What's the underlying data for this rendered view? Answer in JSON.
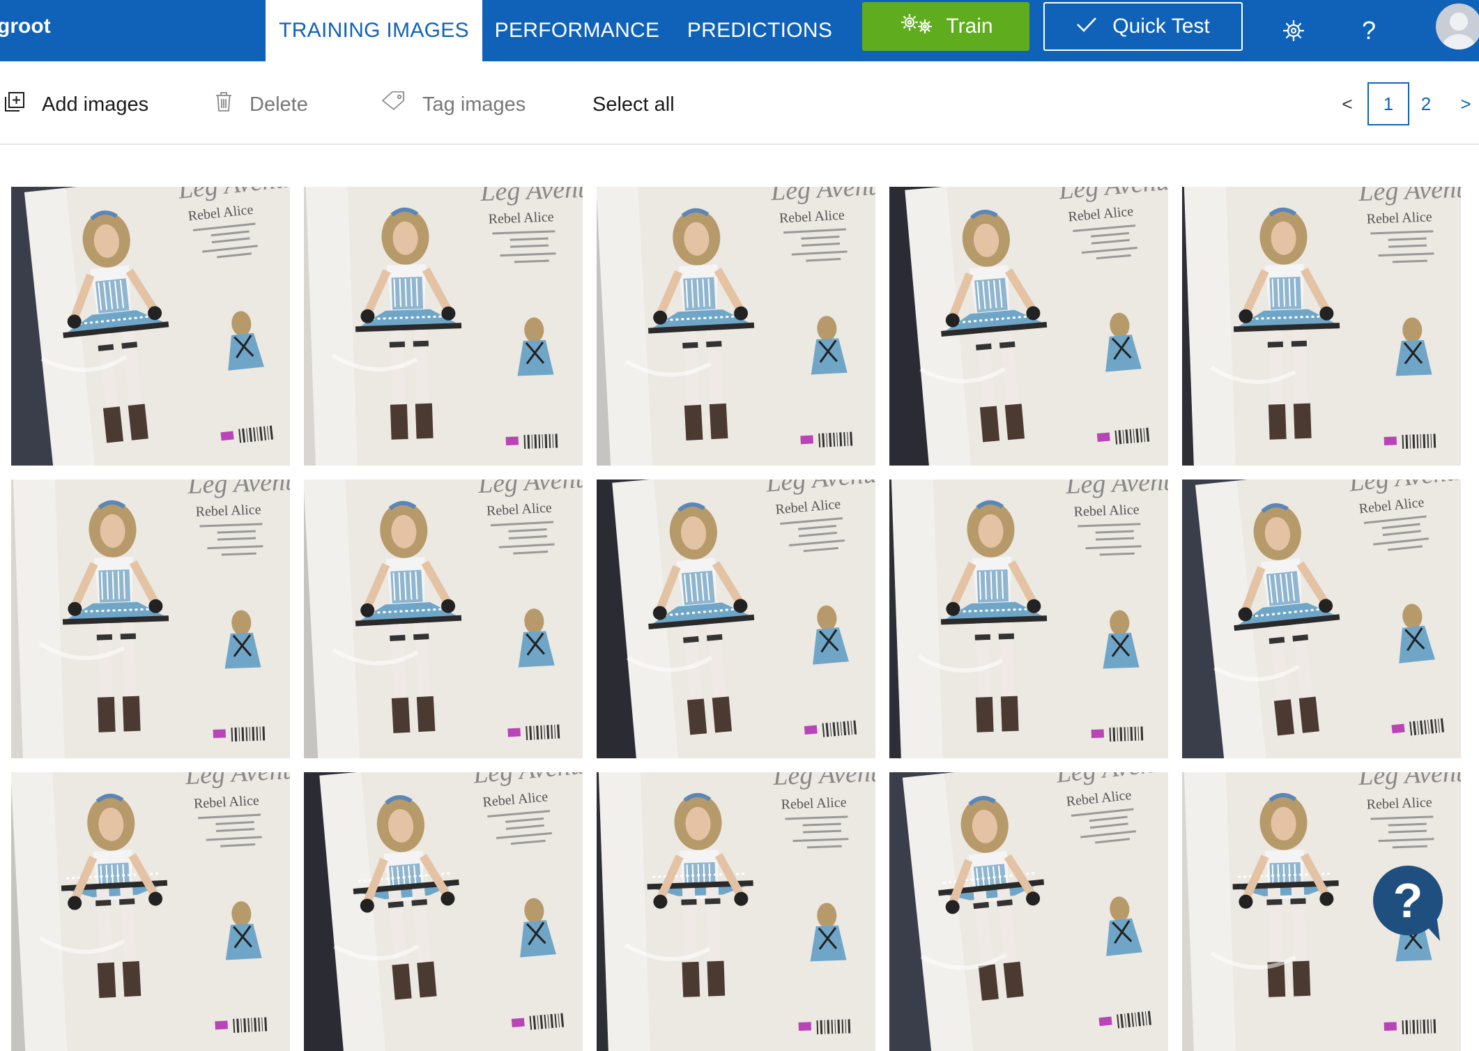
{
  "header": {
    "brand": "groot",
    "tabs": [
      {
        "label": "TRAINING IMAGES",
        "active": true
      },
      {
        "label": "PERFORMANCE",
        "active": false
      },
      {
        "label": "PREDICTIONS",
        "active": false
      }
    ],
    "train_label": "Train",
    "quick_test_label": "Quick Test",
    "help_label": "?",
    "icons": [
      "gears-icon",
      "checkmark-icon",
      "gear-icon",
      "help-icon",
      "avatar"
    ]
  },
  "toolbar": {
    "add_images": "Add images",
    "delete": "Delete",
    "tag_images": "Tag images",
    "select_all": "Select all"
  },
  "pagination": {
    "prev": "<",
    "pages": [
      "1",
      "2"
    ],
    "current": "1",
    "next": ">"
  },
  "colors": {
    "header_bg": "#0f62b8",
    "train_green": "#5fad1e",
    "help_bubble": "#1f4f7f"
  },
  "images": {
    "count_visible": 15,
    "product_text": "Rebel Alice",
    "brand_text": "Leg Avenue"
  },
  "help_bubble_label": "?"
}
